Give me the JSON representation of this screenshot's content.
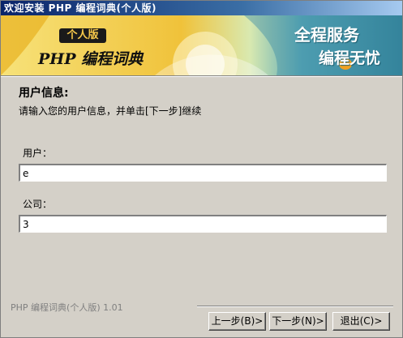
{
  "window": {
    "title": "欢迎安装  PHP  编程词典(个人版)"
  },
  "banner": {
    "edition_badge": "个人版",
    "product_name": "PHP 编程词典",
    "slogan_line1": "全程服务",
    "slogan_line2": "编程无忧"
  },
  "page": {
    "heading": "用户信息:",
    "instruction": "请输入您的用户信息，并单击[下一步]继续"
  },
  "form": {
    "user_label": "用户：",
    "user_value": "e",
    "company_label": "公司：",
    "company_value": "3"
  },
  "footer": {
    "version": "PHP 编程词典(个人版) 1.01",
    "back_label": "上一步(B)>",
    "next_label": "下一步(N)>",
    "exit_label": "退出(C)>"
  }
}
